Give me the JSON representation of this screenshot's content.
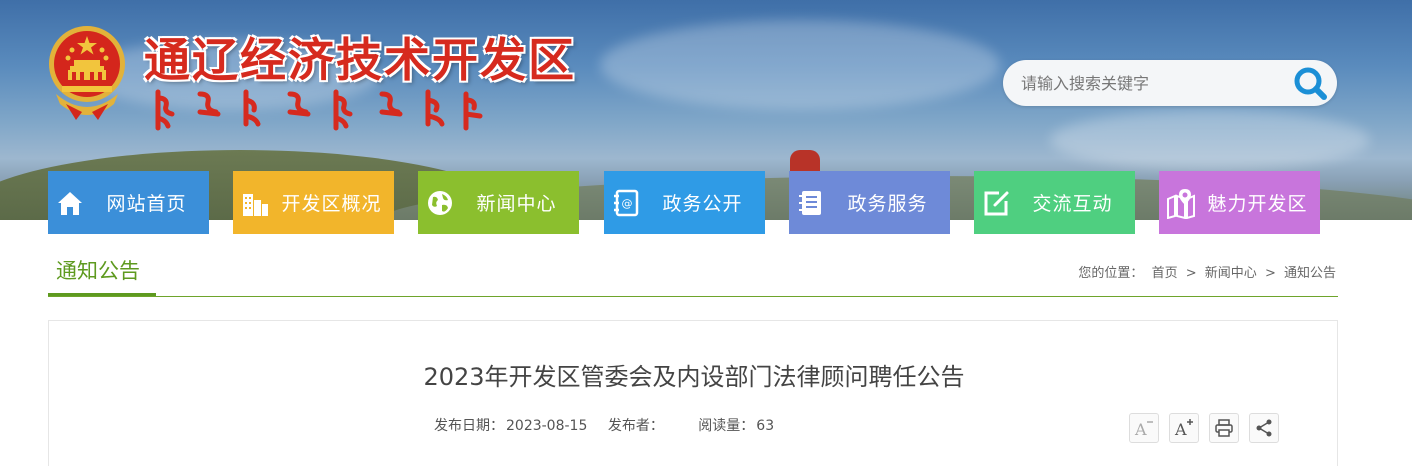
{
  "header": {
    "site_title": "通辽经济技术开发区",
    "search": {
      "placeholder": "请输入搜索关键字"
    }
  },
  "nav": {
    "items": [
      {
        "label": "网站首页",
        "icon": "home-icon",
        "color": "#3b8fd9"
      },
      {
        "label": "开发区概况",
        "icon": "buildings-icon",
        "color": "#f2b52b"
      },
      {
        "label": "新闻中心",
        "icon": "globe-icon",
        "color": "#8bbf2e"
      },
      {
        "label": "政务公开",
        "icon": "contacts-book-icon",
        "color": "#2f9be6"
      },
      {
        "label": "政务服务",
        "icon": "notebook-icon",
        "color": "#6e8ad8"
      },
      {
        "label": "交流互动",
        "icon": "edit-icon",
        "color": "#4fcf80"
      },
      {
        "label": "魅力开发区",
        "icon": "map-pin-icon",
        "color": "#c875dc"
      }
    ]
  },
  "section": {
    "title": "通知公告",
    "breadcrumb": {
      "prefix": "您的位置：",
      "items": [
        "首页",
        "新闻中心",
        "通知公告"
      ],
      "separator": ">"
    }
  },
  "article": {
    "title": "2023年开发区管委会及内设部门法律顾问聘任公告",
    "date_label": "发布日期：",
    "date": "2023-08-15",
    "publisher_label": "发布者：",
    "publisher": "",
    "views_label": "阅读量：",
    "views": "63",
    "tools": [
      "font-decrease-icon",
      "font-increase-icon",
      "print-icon",
      "share-icon"
    ]
  },
  "colors": {
    "accent_green": "#5e9a1f",
    "title_red": "#d62a1e",
    "search_icon_blue": "#1b8fd6"
  }
}
